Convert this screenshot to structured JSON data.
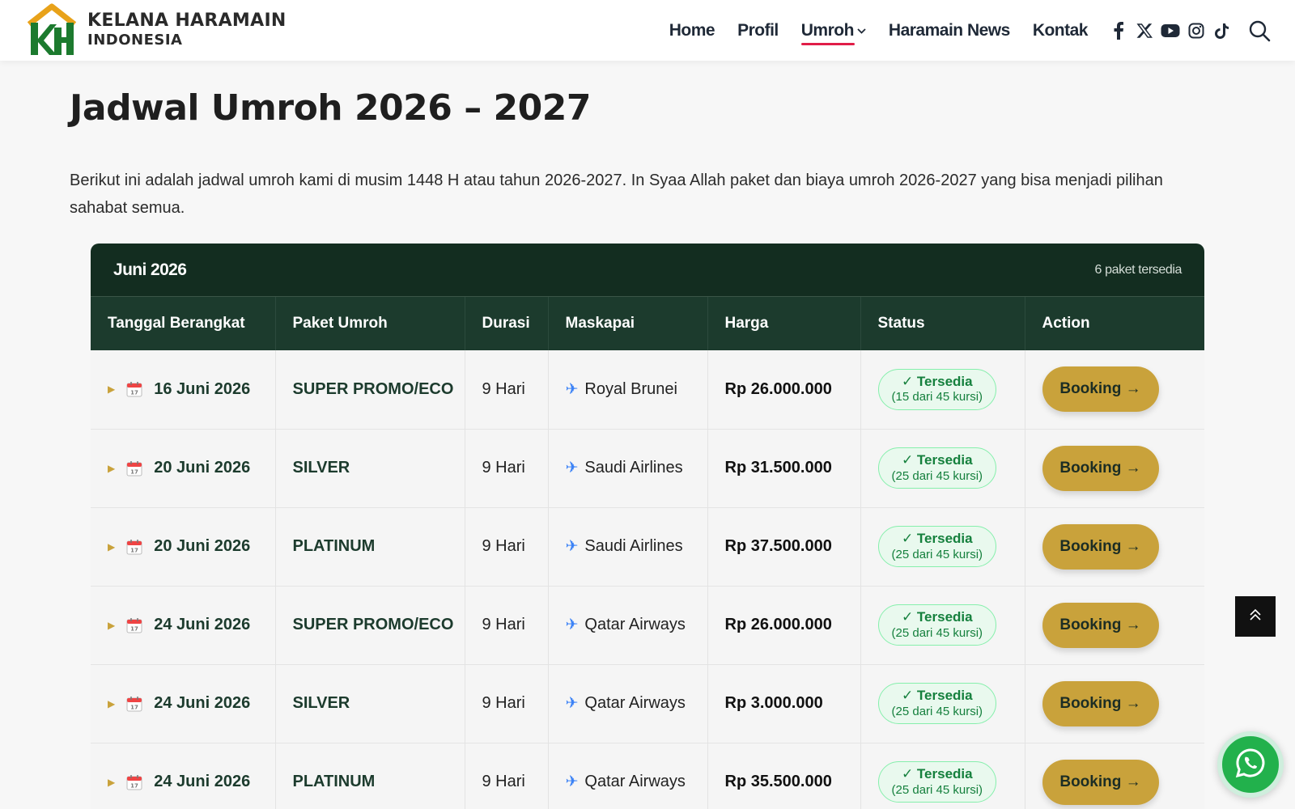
{
  "brand": {
    "name_line1": "KELANA HARAMAIN",
    "name_line2": "INDONESIA",
    "colors": {
      "green": "#1c7a2e",
      "gold": "#e8a21a"
    }
  },
  "nav": {
    "items": [
      {
        "label": "Home"
      },
      {
        "label": "Profil"
      },
      {
        "label": "Umroh",
        "active": true,
        "has_dropdown": true
      },
      {
        "label": "Haramain News"
      },
      {
        "label": "Kontak"
      }
    ],
    "socials": [
      "facebook-icon",
      "x-icon",
      "youtube-icon",
      "instagram-icon",
      "tiktok-icon"
    ],
    "search_icon": "search-icon"
  },
  "page": {
    "title": "Jadwal Umroh 2026 – 2027",
    "intro": "Berikut ini adalah jadwal umroh kami di musim 1448 H atau tahun 2026-2027. In Syaa Allah paket dan biaya umroh 2026-2027 yang bisa menjadi pilihan sahabat semua."
  },
  "schedule": {
    "month": "Juni 2026",
    "count_text": "6 paket tersedia",
    "columns": [
      "Tanggal Berangkat",
      "Paket Umroh",
      "Durasi",
      "Maskapai",
      "Harga",
      "Status",
      "Action"
    ],
    "rows": [
      {
        "date": "16 Juni 2026",
        "package": "SUPER PROMO/ECO",
        "duration": "9 Hari",
        "airline": "Royal Brunei",
        "price": "Rp 26.000.000",
        "status": "✓ Tersedia",
        "seats": "(15 dari 45 kursi)",
        "action": "Booking →"
      },
      {
        "date": "20 Juni 2026",
        "package": "SILVER",
        "duration": "9 Hari",
        "airline": "Saudi Airlines",
        "price": "Rp 31.500.000",
        "status": "✓ Tersedia",
        "seats": "(25 dari 45 kursi)",
        "action": "Booking →"
      },
      {
        "date": "20 Juni 2026",
        "package": "PLATINUM",
        "duration": "9 Hari",
        "airline": "Saudi Airlines",
        "price": "Rp 37.500.000",
        "status": "✓ Tersedia",
        "seats": "(25 dari 45 kursi)",
        "action": "Booking →"
      },
      {
        "date": "24 Juni 2026",
        "package": "SUPER PROMO/ECO",
        "duration": "9 Hari",
        "airline": "Qatar Airways",
        "price": "Rp 26.000.000",
        "status": "✓ Tersedia",
        "seats": "(25 dari 45 kursi)",
        "action": "Booking →"
      },
      {
        "date": "24 Juni 2026",
        "package": "SILVER",
        "duration": "9 Hari",
        "airline": "Qatar Airways",
        "price": "Rp 3.000.000",
        "status": "✓ Tersedia",
        "seats": "(25 dari 45 kursi)",
        "action": "Booking →"
      },
      {
        "date": "24 Juni 2026",
        "package": "PLATINUM",
        "duration": "9 Hari",
        "airline": "Qatar Airways",
        "price": "Rp 35.500.000",
        "status": "✓ Tersedia",
        "seats": "(25 dari 45 kursi)",
        "action": "Booking →"
      }
    ]
  },
  "floating": {
    "scroll_top_icon": "chevrons-up-icon",
    "whatsapp_icon": "whatsapp-icon"
  }
}
